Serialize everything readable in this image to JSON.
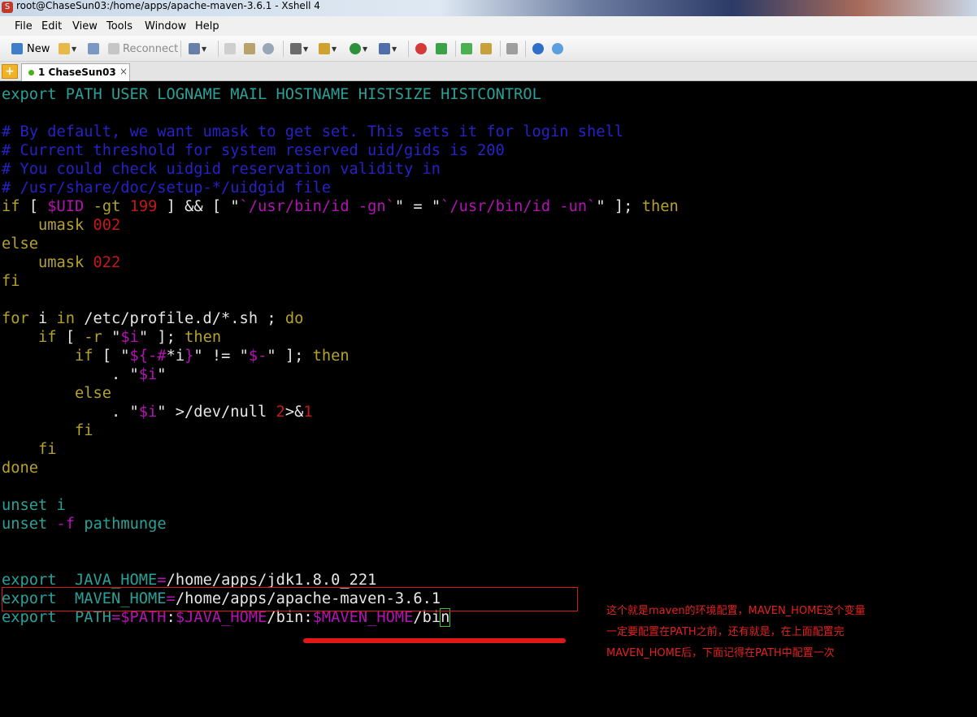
{
  "window": {
    "title": "root@ChaseSun03:/home/apps/apache-maven-3.6.1 - Xshell 4"
  },
  "menu": [
    "File",
    "Edit",
    "View",
    "Tools",
    "Window",
    "Help"
  ],
  "toolbar": {
    "new_label": "New",
    "reconnect_label": "Reconnect"
  },
  "tabs": [
    {
      "label": "1 ChaseSun03",
      "close": "×"
    }
  ],
  "terminal": {
    "lines": [
      [
        [
          "c",
          "export"
        ],
        [
          "w",
          " "
        ],
        [
          "c",
          "PATH USER LOGNAME MAIL HOSTNAME HISTSIZE HISTCONTROL"
        ]
      ],
      [],
      [
        [
          "b",
          "# By default, we want umask to get set. This sets it for login shell"
        ]
      ],
      [
        [
          "b",
          "# Current threshold for system reserved uid/gids is 200"
        ]
      ],
      [
        [
          "b",
          "# You could check uidgid reservation validity in"
        ]
      ],
      [
        [
          "b",
          "# /usr/share/doc/setup-*/uidgid file"
        ]
      ],
      [
        [
          "y",
          "if"
        ],
        [
          "w",
          " [ "
        ],
        [
          "m",
          "$UID"
        ],
        [
          "w",
          " "
        ],
        [
          "y",
          "-gt"
        ],
        [
          "w",
          " "
        ],
        [
          "r",
          "199"
        ],
        [
          "w",
          " ] && [ \""
        ],
        [
          "m",
          "`/usr/bin/id -gn`"
        ],
        [
          "w",
          "\" = \""
        ],
        [
          "m",
          "`/usr/bin/id -un`"
        ],
        [
          "w",
          "\" ]; "
        ],
        [
          "y",
          "then"
        ]
      ],
      [
        [
          "w",
          "    "
        ],
        [
          "y",
          "umask"
        ],
        [
          "w",
          " "
        ],
        [
          "r",
          "002"
        ]
      ],
      [
        [
          "y",
          "else"
        ]
      ],
      [
        [
          "w",
          "    "
        ],
        [
          "y",
          "umask"
        ],
        [
          "w",
          " "
        ],
        [
          "r",
          "022"
        ]
      ],
      [
        [
          "y",
          "fi"
        ]
      ],
      [],
      [
        [
          "y",
          "for"
        ],
        [
          "w",
          " i "
        ],
        [
          "y",
          "in"
        ],
        [
          "w",
          " /etc/profile.d/*.sh ; "
        ],
        [
          "y",
          "do"
        ]
      ],
      [
        [
          "w",
          "    "
        ],
        [
          "y",
          "if"
        ],
        [
          "w",
          " [ "
        ],
        [
          "y",
          "-r"
        ],
        [
          "w",
          " \""
        ],
        [
          "m",
          "$i"
        ],
        [
          "w",
          "\" ]; "
        ],
        [
          "y",
          "then"
        ]
      ],
      [
        [
          "w",
          "        "
        ],
        [
          "y",
          "if"
        ],
        [
          "w",
          " [ \""
        ],
        [
          "m",
          "${-#"
        ],
        [
          "w",
          "*i"
        ],
        [
          "m",
          "}"
        ],
        [
          "w",
          "\" != \""
        ],
        [
          "m",
          "$-"
        ],
        [
          "w",
          "\" ]; "
        ],
        [
          "y",
          "then"
        ]
      ],
      [
        [
          "w",
          "            . \""
        ],
        [
          "m",
          "$i"
        ],
        [
          "w",
          "\""
        ]
      ],
      [
        [
          "w",
          "        "
        ],
        [
          "y",
          "else"
        ]
      ],
      [
        [
          "w",
          "            . \""
        ],
        [
          "m",
          "$i"
        ],
        [
          "w",
          "\" >/dev/null "
        ],
        [
          "r",
          "2"
        ],
        [
          "w",
          ">&"
        ],
        [
          "r",
          "1"
        ]
      ],
      [
        [
          "w",
          "        "
        ],
        [
          "y",
          "fi"
        ]
      ],
      [
        [
          "w",
          "    "
        ],
        [
          "y",
          "fi"
        ]
      ],
      [
        [
          "y",
          "done"
        ]
      ],
      [],
      [
        [
          "c",
          "unset"
        ],
        [
          "w",
          " "
        ],
        [
          "c",
          "i"
        ]
      ],
      [
        [
          "c",
          "unset"
        ],
        [
          "w",
          " "
        ],
        [
          "m",
          "-f"
        ],
        [
          "w",
          " "
        ],
        [
          "c",
          "pathmunge"
        ]
      ],
      [],
      [],
      [
        [
          "c",
          "export"
        ],
        [
          "w",
          "  "
        ],
        [
          "c",
          "JAVA_HOME"
        ],
        [
          "m",
          "="
        ],
        [
          "w",
          "/home/apps/jdk1.8.0_221"
        ]
      ],
      [
        [
          "c",
          "export"
        ],
        [
          "w",
          "  "
        ],
        [
          "c",
          "MAVEN_HOME"
        ],
        [
          "m",
          "="
        ],
        [
          "w",
          "/home/apps/apache-maven-3.6.1"
        ]
      ],
      [
        [
          "c",
          "export"
        ],
        [
          "w",
          "  "
        ],
        [
          "c",
          "PATH"
        ],
        [
          "m",
          "=$PATH"
        ],
        [
          "w",
          ":"
        ],
        [
          "m",
          "$JAVA_HOME"
        ],
        [
          "w",
          "/bin:"
        ],
        [
          "m",
          "$MAVEN_HOME"
        ],
        [
          "w",
          "/bi"
        ],
        [
          "cursor",
          "n"
        ]
      ]
    ]
  },
  "annotation": {
    "color": "#e52020",
    "lines": [
      "这个就是maven的环境配置，MAVEN_HOME这个变量",
      "一定要配置在PATH之前，还有就是，在上面配置完",
      "MAVEN_HOME后，下面记得在PATH中配置一次"
    ]
  }
}
